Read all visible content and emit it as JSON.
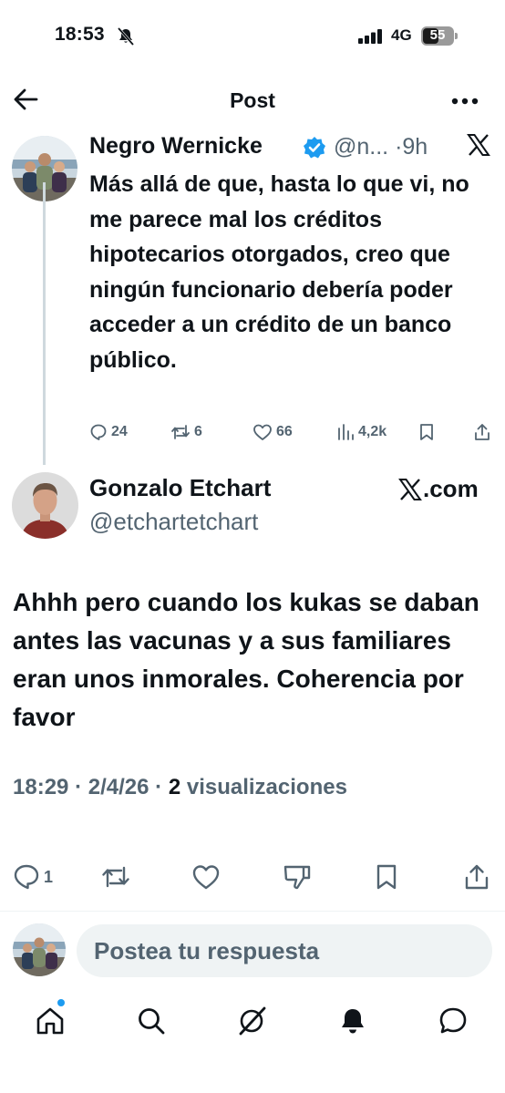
{
  "status_bar": {
    "time": "18:53",
    "network": "4G",
    "battery": "55"
  },
  "header": {
    "title": "Post"
  },
  "quoted_post": {
    "author_name": "Negro Wernicke",
    "author_handle": "@n...",
    "separator": "·",
    "time_ago": "9h",
    "text": "Más allá de que, hasta lo que vi, no me parece mal los créditos hipotecarios otorgados, creo que ningún funcionario debería poder acceder a un crédito de un banco público.",
    "replies": "24",
    "reposts": "6",
    "likes": "66",
    "views": "4,2k"
  },
  "author": {
    "name": "Gonzalo Etchart",
    "handle": "@etchartetchart",
    "source_label": ".com"
  },
  "post": {
    "text": "Ahhh pero cuando los kukas se daban antes las vacunas y a sus familiares eran unos inmorales. Coherencia por favor",
    "time": "18:29",
    "date": "2/4/26",
    "views_count": "2",
    "views_label": "visualizaciones",
    "separator": "·"
  },
  "actions": {
    "reply_count": "1"
  },
  "reply": {
    "placeholder": "Postea tu respuesta"
  },
  "colors": {
    "accent": "#1d9bf0",
    "text": "#0f1419",
    "secondary": "#536471",
    "line": "#cfd9de",
    "input_bg": "#eff3f4"
  },
  "icons": [
    "back-arrow-icon",
    "more-icon",
    "verified-icon",
    "x-logo-icon",
    "reply-icon",
    "repost-icon",
    "like-icon",
    "views-icon",
    "bookmark-icon",
    "share-icon",
    "dislike-icon",
    "home-icon",
    "search-icon",
    "grok-icon",
    "notifications-icon",
    "messages-icon"
  ]
}
